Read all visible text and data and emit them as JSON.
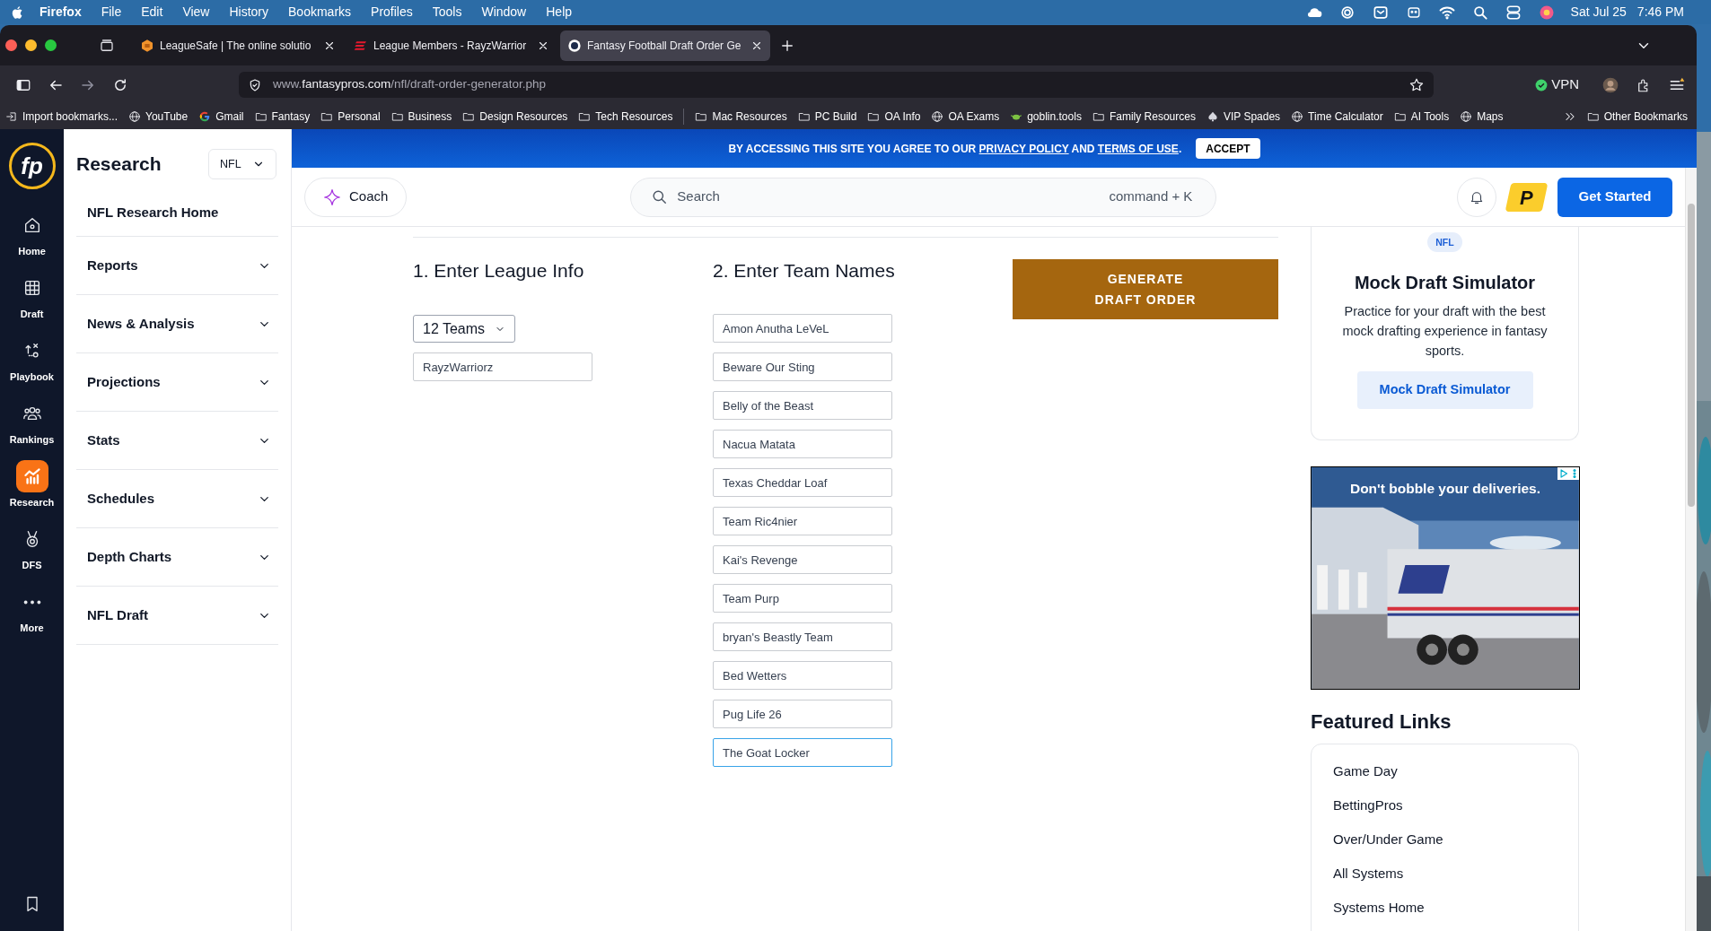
{
  "menu_bar": {
    "app": "Firefox",
    "items": [
      "File",
      "Edit",
      "View",
      "History",
      "Bookmarks",
      "Profiles",
      "Tools",
      "Window",
      "Help"
    ],
    "date": "Sat Jul 25",
    "time": "7:46 PM"
  },
  "tabs": [
    {
      "title": "LeagueSafe | The online solutio",
      "kind": "leaguesafe",
      "selected": false
    },
    {
      "title": "League Members - RayzWarrior",
      "kind": "espn",
      "selected": false
    },
    {
      "title": "Fantasy Football Draft Order Ge",
      "kind": "fp",
      "selected": true
    }
  ],
  "address_bar": {
    "prefix": "www.",
    "host": "fantasypros.com",
    "path": "/nfl/draft-order-generator.php"
  },
  "vpn": {
    "label": "VPN",
    "on": true
  },
  "bookmarks": [
    {
      "label": "Import bookmarks...",
      "kind": "import"
    },
    {
      "label": "YouTube",
      "kind": "globe"
    },
    {
      "label": "Gmail",
      "kind": "google"
    },
    {
      "label": "Fantasy",
      "kind": "folder"
    },
    {
      "label": "Personal",
      "kind": "folder"
    },
    {
      "label": "Business",
      "kind": "folder"
    },
    {
      "label": "Design Resources",
      "kind": "folder"
    },
    {
      "label": "Tech Resources",
      "kind": "folder"
    },
    {
      "kind": "separator"
    },
    {
      "label": "Mac Resources",
      "kind": "folder"
    },
    {
      "label": "PC Build",
      "kind": "folder"
    },
    {
      "label": "OA Info",
      "kind": "folder"
    },
    {
      "label": "OA Exams",
      "kind": "globe"
    },
    {
      "label": "goblin.tools",
      "kind": "goblin"
    },
    {
      "label": "Family Resources",
      "kind": "folder"
    },
    {
      "label": "VIP Spades",
      "kind": "spade"
    },
    {
      "label": "Time Calculator",
      "kind": "globe"
    },
    {
      "label": "AI Tools",
      "kind": "folder"
    },
    {
      "label": "Maps",
      "kind": "globe"
    }
  ],
  "other_bookmarks": "Other Bookmarks",
  "logo": "fp",
  "nav_rail": [
    {
      "label": "Home",
      "kind": "home",
      "selected": false
    },
    {
      "label": "Draft",
      "kind": "grid",
      "selected": false
    },
    {
      "label": "Playbook",
      "kind": "play",
      "selected": false
    },
    {
      "label": "Rankings",
      "kind": "people",
      "selected": false
    },
    {
      "label": "Research",
      "kind": "chart",
      "selected": true
    },
    {
      "label": "DFS",
      "kind": "medal",
      "selected": false
    },
    {
      "label": "More",
      "kind": "dots",
      "selected": false
    }
  ],
  "sidebar": {
    "title": "Research",
    "league_select": "NFL",
    "home_link": "NFL Research Home",
    "sections": [
      {
        "label": "Reports",
        "expanded": false
      },
      {
        "label": "News & Analysis",
        "expanded": false
      },
      {
        "label": "Projections",
        "expanded": false
      },
      {
        "label": "Stats",
        "expanded": false
      },
      {
        "label": "Schedules",
        "expanded": false
      },
      {
        "label": "Depth Charts",
        "expanded": false
      },
      {
        "label": "NFL Draft",
        "expanded": false
      }
    ]
  },
  "consent_banner": {
    "parts": [
      {
        "kind": "text",
        "text": "BY ACCESSING THIS SITE YOU AGREE TO OUR "
      },
      {
        "kind": "link",
        "text": "PRIVACY POLICY"
      },
      {
        "kind": "text",
        "text": " AND "
      },
      {
        "kind": "link",
        "text": "TERMS OF USE"
      },
      {
        "kind": "text",
        "text": "."
      }
    ],
    "accept": "ACCEPT"
  },
  "header": {
    "coach": "Coach",
    "search": {
      "placeholder": "Search",
      "shortcut": "command + K"
    },
    "brand_mark": "P",
    "cta": "Get Started"
  },
  "form": {
    "league_heading": "1. Enter League Info",
    "team_count": "12 Teams",
    "league_name": "RayzWarriorz",
    "teams_heading": "2. Enter Team Names",
    "teams": [
      {
        "value": "Amon Anutha LeVeL",
        "focused": false
      },
      {
        "value": "Beware Our Sting",
        "focused": false
      },
      {
        "value": "Belly of the Beast",
        "focused": false
      },
      {
        "value": "Nacua Matata",
        "focused": false
      },
      {
        "value": "Texas Cheddar Loaf",
        "focused": false
      },
      {
        "value": "Team Ric4nier",
        "focused": false
      },
      {
        "value": "Kai's Revenge",
        "focused": false
      },
      {
        "value": "Team Purp",
        "focused": false
      },
      {
        "value": "bryan's Beastly Team",
        "focused": false
      },
      {
        "value": "Bed Wetters",
        "focused": false
      },
      {
        "value": "Pug Life 26",
        "focused": false
      },
      {
        "value": "The Goat Locker",
        "focused": true
      }
    ],
    "generate": "GENERATE DRAFT ORDER"
  },
  "promo_card": {
    "badge": "NFL",
    "title": "Mock Draft Simulator",
    "description": "Practice for your draft with the best mock drafting experience in fantasy sports.",
    "button": "Mock Draft Simulator"
  },
  "ad": {
    "kind": "picture",
    "headline": "Don't bobble your deliveries."
  },
  "featured_links": {
    "title": "Featured Links",
    "items": [
      "Game Day",
      "BettingPros",
      "Over/Under Game",
      "All Systems",
      "Systems Home"
    ]
  }
}
